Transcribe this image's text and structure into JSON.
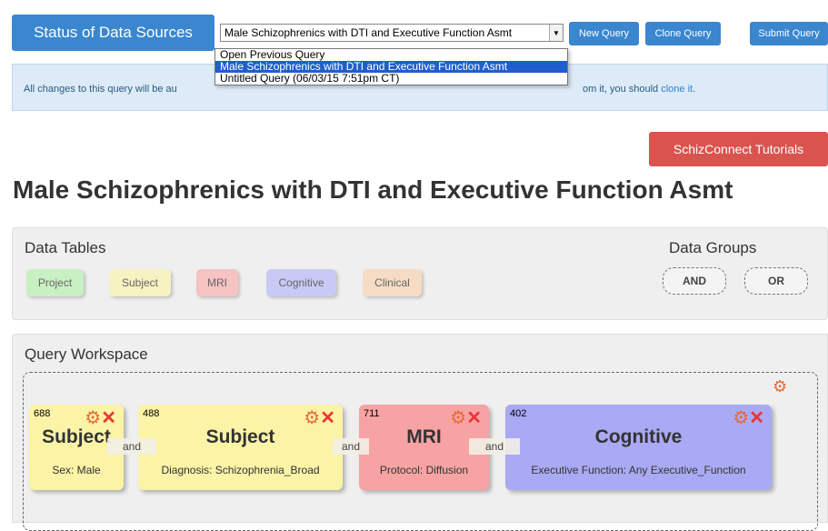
{
  "header": {
    "status_button": "Status of Data Sources",
    "query_select_value": "Male Schizophrenics with DTI and Executive Function Asmt",
    "new_query": "New Query",
    "clone_query": "Clone Query",
    "submit_query": "Submit Query"
  },
  "dropdown": {
    "options": [
      "Open Previous Query",
      "Male Schizophrenics with DTI and Executive Function Asmt",
      "Untitled Query (06/03/15 7:51pm CT)"
    ],
    "selected_index": 1
  },
  "alert": {
    "text_start": "All changes to this query will be au",
    "text_end": "om it, you should ",
    "link": "clone it",
    "text_tail": "."
  },
  "tutorials_button": "SchizConnect Tutorials",
  "page_title": "Male Schizophrenics with DTI and Executive Function Asmt",
  "data_tables": {
    "title": "Data Tables",
    "chips": [
      {
        "label": "Project",
        "color": "#c9f0c2"
      },
      {
        "label": "Subject",
        "color": "#f7f2c2"
      },
      {
        "label": "MRI",
        "color": "#f6c2c2"
      },
      {
        "label": "Cognitive",
        "color": "#c9c9f5"
      },
      {
        "label": "Clinical",
        "color": "#f6dcc4"
      }
    ]
  },
  "data_groups": {
    "title": "Data Groups",
    "and": "AND",
    "or": "OR"
  },
  "workspace": {
    "title": "Query Workspace",
    "join_label": "and",
    "cards": [
      {
        "count": "688",
        "title": "Subject",
        "criteria": "Sex: Male",
        "color": "#fbf3a6"
      },
      {
        "count": "488",
        "title": "Subject",
        "criteria": "Diagnosis: Schizophrenia_Broad",
        "color": "#fbf3a6"
      },
      {
        "count": "711",
        "title": "MRI",
        "criteria": "Protocol: Diffusion",
        "color": "#f7a3a3"
      },
      {
        "count": "402",
        "title": "Cognitive",
        "criteria": "Executive Function: Any Executive_Function",
        "color": "#aaa9f3"
      }
    ]
  },
  "icons": {
    "gear": "gear-icon",
    "remove": "close-icon",
    "dropdown_arrow": "chevron-down-icon"
  },
  "colors": {
    "primary": "#3a87d0",
    "danger": "#d9534f",
    "gear": "#e8693a",
    "remove": "#e33333"
  }
}
